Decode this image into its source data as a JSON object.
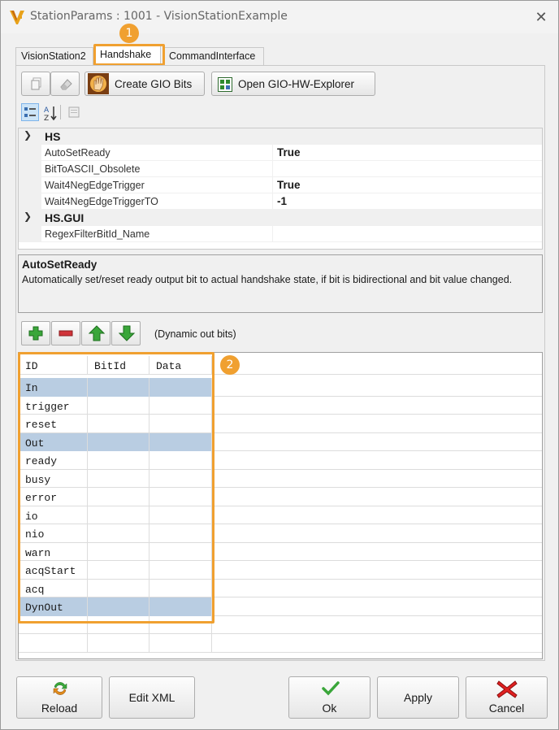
{
  "window": {
    "title": "StationParams : 1001 - VisionStationExample",
    "close_icon": "close-icon",
    "logo_icon": "vision-logo-icon"
  },
  "tabs": [
    {
      "label": "VisionStation2",
      "active": false
    },
    {
      "label": "Handshake",
      "active": true
    },
    {
      "label": "CommandInterface",
      "active": false
    }
  ],
  "callouts": {
    "one": "1",
    "two": "2",
    "color": "#f0a030"
  },
  "toolbar": {
    "copy_icon": "copy-icon",
    "eraser_icon": "eraser-icon",
    "create_gio_label": "Create GIO Bits",
    "create_gio_icon": "hand-gesture-icon",
    "open_explorer_label": "Open GIO-HW-Explorer",
    "open_explorer_icon": "grid-window-icon"
  },
  "propgrid_toolbar": {
    "categorized_icon": "categorized-icon",
    "sort_az_icon": "sort-az-icon",
    "property_pages_icon": "property-pages-icon"
  },
  "propgrid": {
    "categories": [
      {
        "name": "HS",
        "properties": [
          {
            "name": "AutoSetReady",
            "value": "True"
          },
          {
            "name": "BitToASCII_Obsolete",
            "value": ""
          },
          {
            "name": "Wait4NegEdgeTrigger",
            "value": "True"
          },
          {
            "name": "Wait4NegEdgeTriggerTO",
            "value": "-1"
          }
        ]
      },
      {
        "name": "HS.GUI",
        "properties": [
          {
            "name": "RegexFilterBitId_Name",
            "value": ""
          }
        ]
      }
    ]
  },
  "description": {
    "title": "AutoSetReady",
    "text": "Automatically set/reset ready output bit to actual handshake state, if bit is bidirectional and bit value changed."
  },
  "bits_toolbar": {
    "add_icon": "plus-icon",
    "remove_icon": "minus-icon",
    "up_icon": "arrow-up-icon",
    "down_icon": "arrow-down-icon",
    "caption": "(Dynamic out bits)"
  },
  "grid": {
    "columns": [
      "ID",
      "BitId",
      "Data"
    ],
    "rows": [
      {
        "id": "In",
        "highlight": true
      },
      {
        "id": "trigger",
        "highlight": false
      },
      {
        "id": "reset",
        "highlight": false
      },
      {
        "id": "Out",
        "highlight": true
      },
      {
        "id": "ready",
        "highlight": false
      },
      {
        "id": "busy",
        "highlight": false
      },
      {
        "id": "error",
        "highlight": false
      },
      {
        "id": "io",
        "highlight": false
      },
      {
        "id": "nio",
        "highlight": false
      },
      {
        "id": "warn",
        "highlight": false
      },
      {
        "id": "acqStart",
        "highlight": false
      },
      {
        "id": "acq",
        "highlight": false
      },
      {
        "id": "DynOut",
        "highlight": true
      }
    ],
    "highlight_color": "#b9cde2"
  },
  "footer": {
    "reload_label": "Reload",
    "reload_icon": "reload-icon",
    "edit_xml_label": "Edit XML",
    "ok_label": "Ok",
    "ok_icon": "checkmark-icon",
    "apply_label": "Apply",
    "cancel_label": "Cancel",
    "cancel_icon": "red-x-icon"
  }
}
